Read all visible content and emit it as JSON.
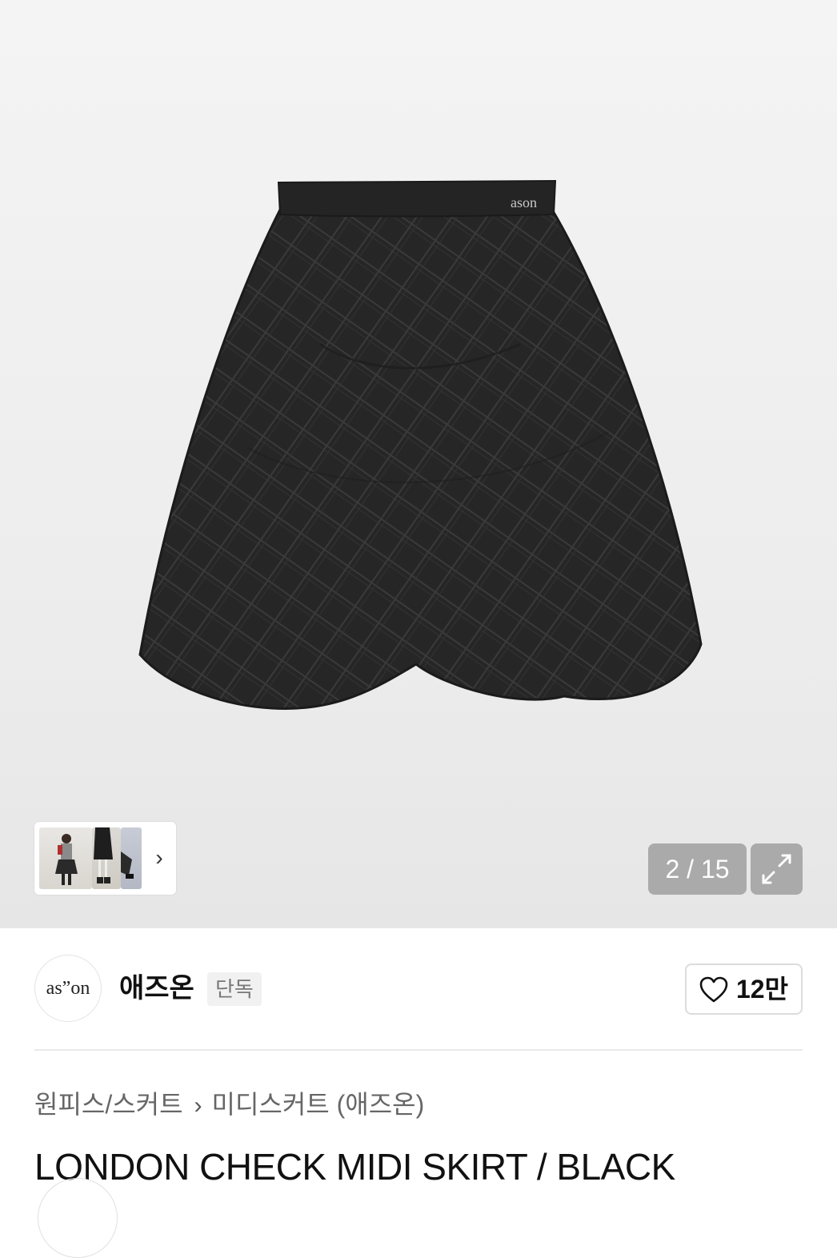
{
  "gallery": {
    "image_alt": "skirt-product-photo",
    "waistband_label": "ason",
    "counter": "2 / 15",
    "thumbnails": [
      "model-photo-1",
      "model-photo-2",
      "model-photo-3"
    ]
  },
  "brand": {
    "logo_text": "as”on",
    "name": "애즈온",
    "badge": "단독",
    "likes": "12만"
  },
  "breadcrumb": {
    "category": "원피스/스커트",
    "subcategory": "미디스커트 (애즈온)"
  },
  "product": {
    "title": "LONDON CHECK MIDI SKIRT / BLACK"
  },
  "colors": {
    "skirt": "#262626",
    "overlay": "#969696"
  }
}
